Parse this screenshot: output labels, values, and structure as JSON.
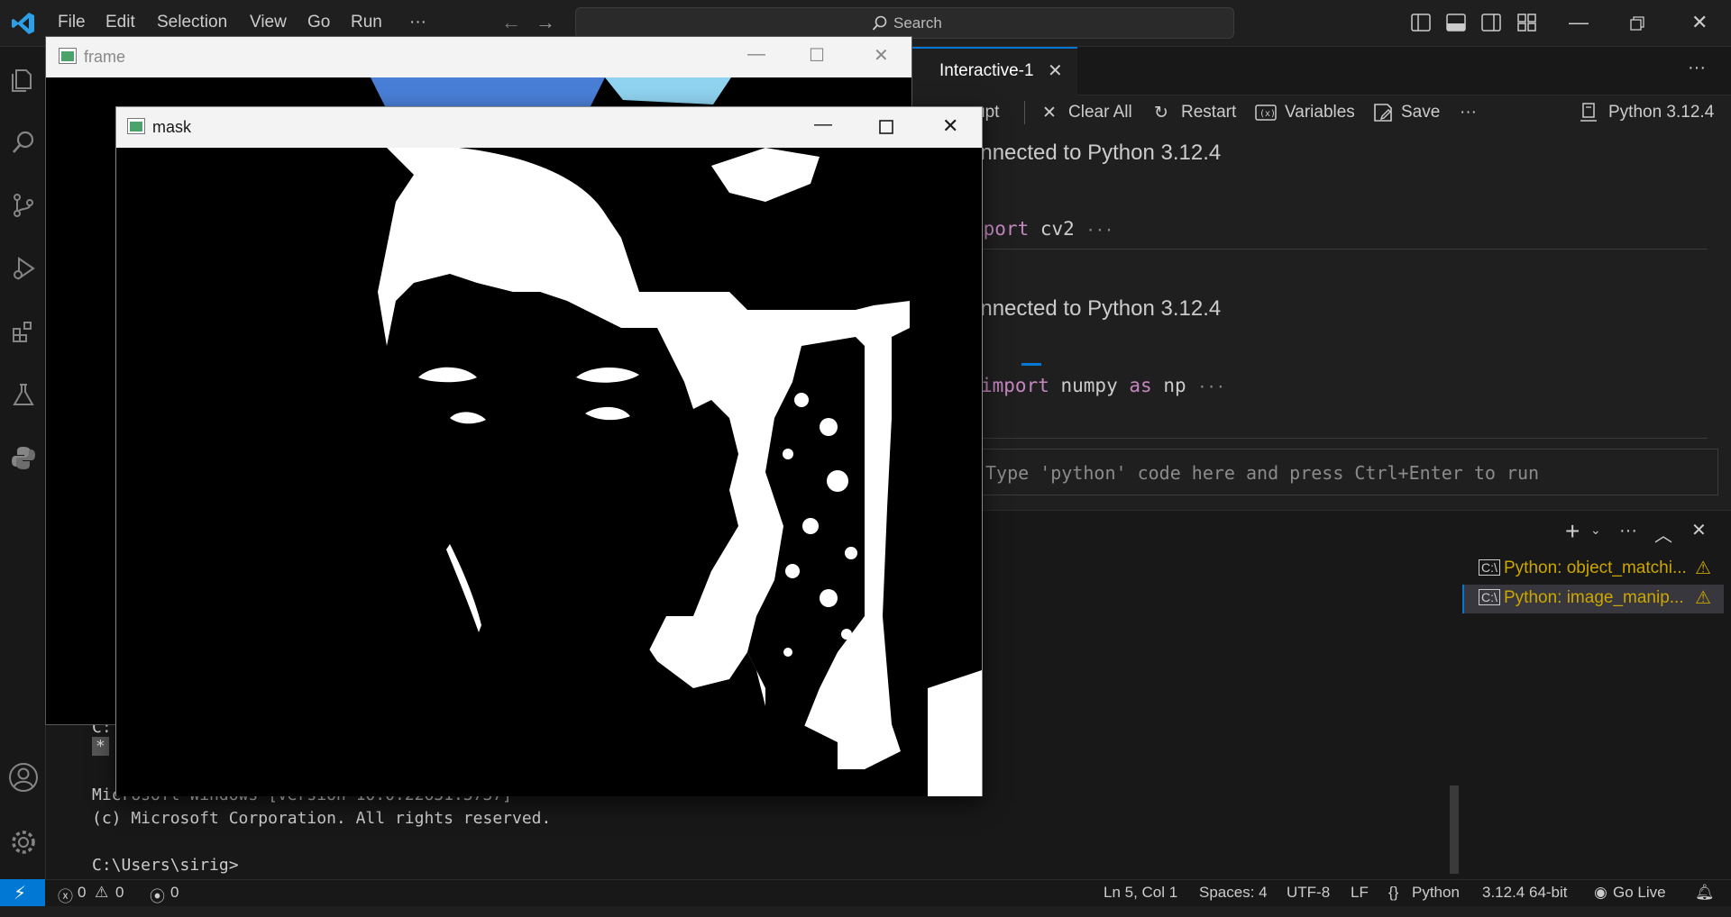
{
  "menu": {
    "file": "File",
    "edit": "Edit",
    "selection": "Selection",
    "view": "View",
    "go": "Go",
    "run": "Run",
    "more": "···"
  },
  "search": {
    "placeholder": "Search"
  },
  "tabs": {
    "interactive_label": "Interactive-1"
  },
  "toolbar": {
    "interrupt": "upt",
    "clear_all": "Clear All",
    "restart": "Restart",
    "variables": "Variables",
    "save": "Save",
    "more": "···",
    "kernel": "Python 3.12.4"
  },
  "editor": {
    "connected1": "onnected to Python 3.12.4",
    "cell1_kw": "mport",
    "cell1_rest": " cv2",
    "ellipsis": "···",
    "connected2": "onnected to Python 3.12.4",
    "cell2_kw1": "import",
    "cell2_mod": " numpy ",
    "cell2_kw2": "as",
    "cell2_alias": " np",
    "input_placeholder": "Type 'python' code here and press Ctrl+Enter to run"
  },
  "terminal": {
    "line_c": "C:",
    "line_star": "*",
    "line_win": "Microsoft Windows [Version 10.0.22631.3737]",
    "line_copy": "(c) Microsoft Corporation. All rights reserved.",
    "prompt": "C:\\Users\\sirig>",
    "list": [
      {
        "label": "Python: object_matchi..."
      },
      {
        "label": "Python: image_manip..."
      }
    ]
  },
  "status": {
    "errors": "0",
    "warnings": "0",
    "ports": "0",
    "position": "Ln 5, Col 1",
    "spaces": "Spaces: 4",
    "encoding": "UTF-8",
    "eol": "LF",
    "language": "Python",
    "interpreter": "3.12.4 64-bit",
    "golive": "Go Live"
  },
  "windows": {
    "frame_title": "frame",
    "mask_title": "mask"
  },
  "colors": {
    "accent": "#0078d4",
    "keyword": "#c586c0",
    "warning": "#cca700"
  }
}
